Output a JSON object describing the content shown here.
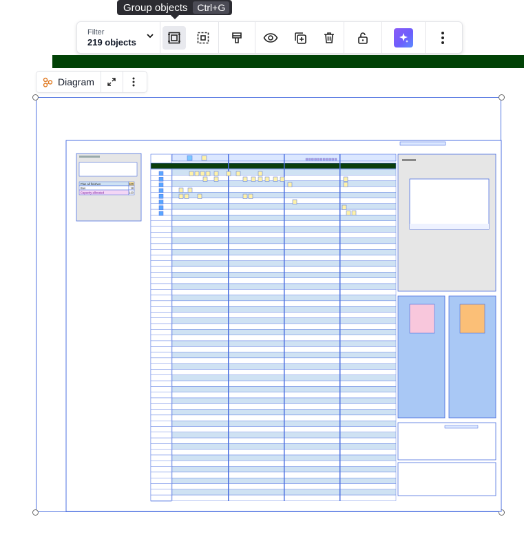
{
  "tooltip": {
    "label": "Group objects",
    "shortcut": "Ctrl+G"
  },
  "toolbar": {
    "filter_label": "Filter",
    "filter_value": "219 objects",
    "buttons": [
      "group-objects",
      "ungroup",
      "format-painter",
      "visibility",
      "duplicate",
      "delete",
      "unlock",
      "ai-assist",
      "more-options"
    ]
  },
  "diagram_chip": {
    "label": "Diagram"
  },
  "colors": {
    "accent": "#4b6fe0",
    "green_bar": "#014206",
    "board_bg": "#e6e6e6",
    "panel_blue": "#a9c8f5",
    "row_blue": "#cfe2f3",
    "sticky_yellow": "#fff2a8",
    "sticky_pink": "#f8c7dc",
    "sticky_orange": "#fbbf77",
    "ai_purple": "#8b5cf6"
  },
  "board": {
    "capacity_table": {
      "rows": [
        {
          "label": "Plan all finishes",
          "value": "100"
        },
        {
          "label": "Bus",
          "value": "18"
        },
        {
          "label": "Capacity allocated",
          "value": "120"
        }
      ]
    }
  }
}
